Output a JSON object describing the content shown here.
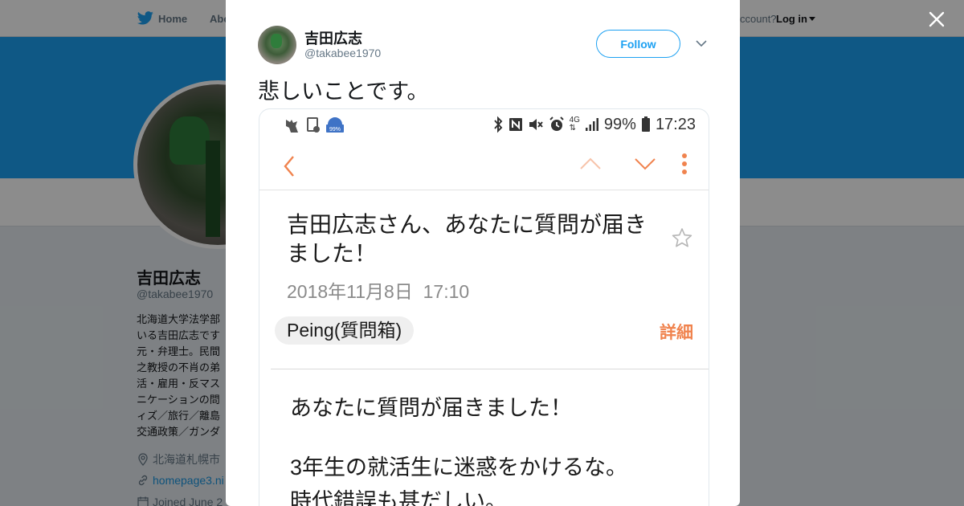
{
  "top_nav": {
    "home_label": "Home",
    "about_label": "Abo",
    "account_prompt": "ccount?",
    "login_label": "Log in",
    "icons": [
      "twitter-bird-icon",
      "caret-down-icon"
    ]
  },
  "profile": {
    "name": "吉田広志",
    "handle": "@takabee1970",
    "bio": "北海道大学法学部\nいる吉田広志です\n元・弁理士。民間\n之教授の不肖の弟\n活・雇用・反マス\nニケーションの問\nィズ／旅行／離島\n交通政策／ガンダ",
    "location": "北海道札幌市",
    "website": "homepage3.ni",
    "joined": "Joined June 2",
    "icons": [
      "location-pin-icon",
      "link-icon",
      "calendar-icon"
    ]
  },
  "modal": {
    "author_name": "吉田広志",
    "author_handle": "@takabee1970",
    "follow_label": "Follow",
    "tweet_text": "悲しいことです。",
    "icons": [
      "close-icon",
      "chevron-down-icon"
    ]
  },
  "email_screenshot": {
    "status_bar": {
      "battery_percent": "99%",
      "time": "17:23",
      "network": "4G",
      "badge_percent": "99%",
      "icons": [
        "bluetooth-icon",
        "nfc-icon",
        "mute-icon",
        "alarm-icon",
        "signal-icon",
        "battery-icon"
      ]
    },
    "app_bar_icons": [
      "back-arrow-icon",
      "previous-arrow-icon",
      "next-arrow-icon",
      "more-vertical-icon"
    ],
    "subject": "吉田広志さん、あなたに質問が届きました！",
    "date": "2018年11月8日  17:10",
    "sender": "Peing(質問箱)",
    "details_label": "詳細",
    "body_line1": "あなたに質問が届きました！",
    "body_line2": "3年生の就活生に迷惑をかけるな。",
    "body_line3": "時代錯誤も甚だしい。"
  },
  "colors": {
    "twitter_blue": "#1da1f2",
    "accent_orange": "#f0834e",
    "overlay": "rgba(0,0,0,0.45)"
  }
}
